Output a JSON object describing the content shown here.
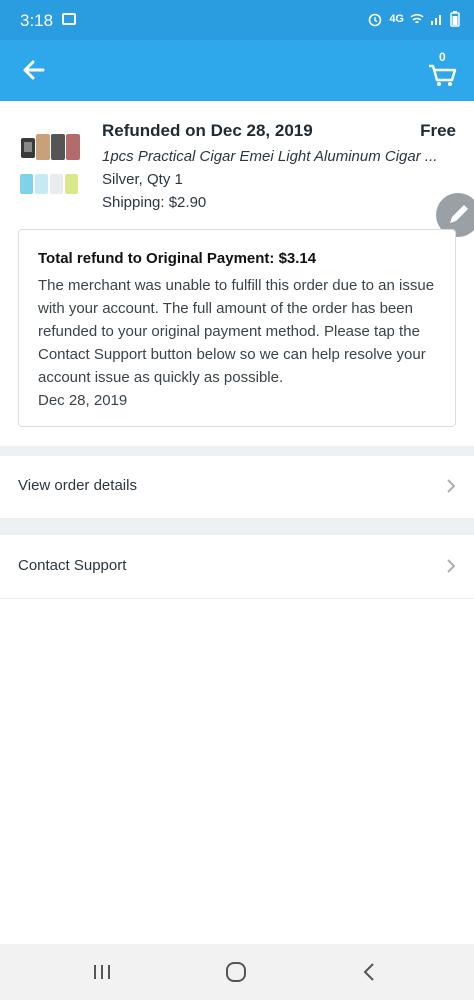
{
  "status_bar": {
    "time": "3:18",
    "network": "4G"
  },
  "app_bar": {
    "cart_count": "0"
  },
  "order": {
    "status_title": "Refunded on Dec 28, 2019",
    "price": "Free",
    "product_name": "1pcs Practical Cigar Emei Light Aluminum Cigar ...",
    "variant": "Silver, Qty 1",
    "shipping": "Shipping: $2.90"
  },
  "refund": {
    "title": "Total refund to Original Payment: $3.14",
    "message": "The merchant was unable to fulfill this order due to an issue with your account. The full amount of the order has been refunded to your original payment method. Please tap the Contact Support button below so we can help resolve your account issue as quickly as possible.",
    "date": "Dec 28, 2019"
  },
  "links": {
    "view_order_details": "View order details",
    "contact_support": "Contact Support"
  },
  "colors": {
    "primary": "#2ea7eb",
    "status_bar": "#2a9ce0",
    "text": "#1f2a33",
    "divider": "#eef1f3"
  },
  "icons": [
    "back-arrow-icon",
    "cart-icon",
    "edit-pencil-icon",
    "chevron-right-icon",
    "recent-apps-icon",
    "home-icon",
    "back-nav-icon"
  ]
}
